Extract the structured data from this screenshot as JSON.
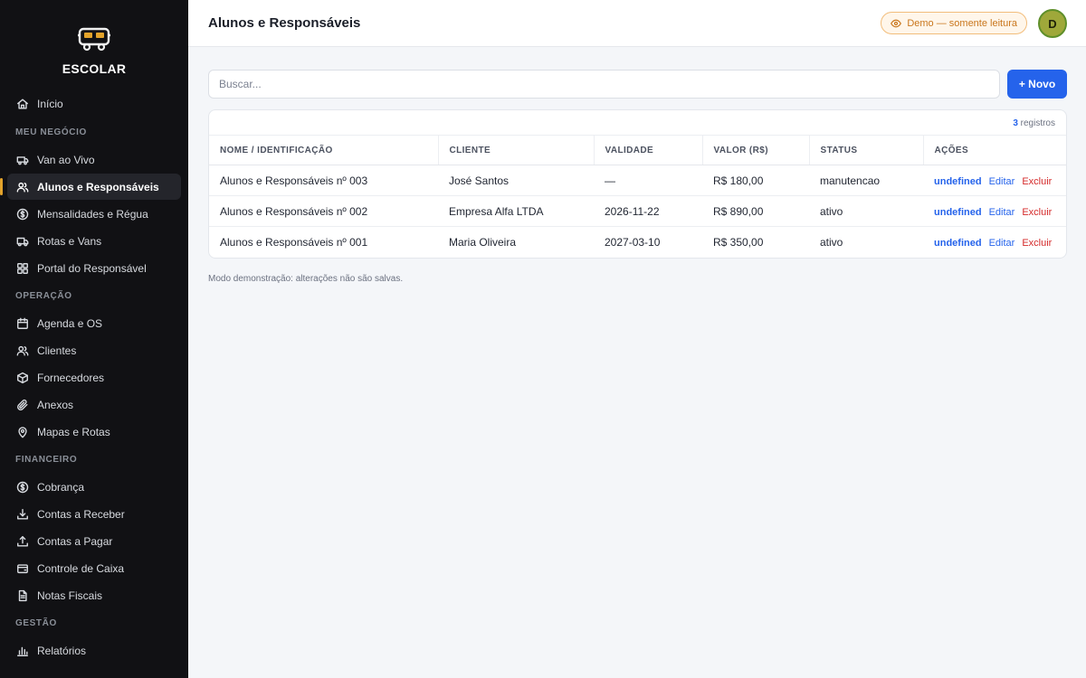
{
  "brand": {
    "name": "ESCOLAR",
    "logo_icon": "school-bus-icon"
  },
  "sidebar": {
    "top_items": [
      {
        "label": "Início",
        "icon": "home-icon"
      }
    ],
    "sections": [
      {
        "title": "MEU NEGÓCIO",
        "items": [
          {
            "label": "Van ao Vivo",
            "icon": "van-icon"
          },
          {
            "label": "Alunos e Responsáveis",
            "icon": "users-icon",
            "active": true
          },
          {
            "label": "Mensalidades e Régua",
            "icon": "dollar-circle-icon"
          },
          {
            "label": "Rotas e Vans",
            "icon": "truck-icon"
          },
          {
            "label": "Portal do Responsável",
            "icon": "grid-icon"
          }
        ]
      },
      {
        "title": "OPERAÇÃO",
        "items": [
          {
            "label": "Agenda e OS",
            "icon": "calendar-icon"
          },
          {
            "label": "Clientes",
            "icon": "users-icon"
          },
          {
            "label": "Fornecedores",
            "icon": "box-icon"
          },
          {
            "label": "Anexos",
            "icon": "paperclip-icon"
          },
          {
            "label": "Mapas e Rotas",
            "icon": "map-pin-icon"
          }
        ]
      },
      {
        "title": "FINANCEIRO",
        "items": [
          {
            "label": "Cobrança",
            "icon": "dollar-circle-icon"
          },
          {
            "label": "Contas a Receber",
            "icon": "download-icon"
          },
          {
            "label": "Contas a Pagar",
            "icon": "upload-icon"
          },
          {
            "label": "Controle de Caixa",
            "icon": "wallet-icon"
          },
          {
            "label": "Notas Fiscais",
            "icon": "file-text-icon"
          }
        ]
      },
      {
        "title": "GESTÃO",
        "items": [
          {
            "label": "Relatórios",
            "icon": "bar-chart-icon"
          }
        ]
      }
    ]
  },
  "header": {
    "title": "Alunos e Responsáveis",
    "demo_badge": "Demo — somente leitura",
    "avatar_initial": "D"
  },
  "toolbar": {
    "search_placeholder": "Buscar...",
    "new_label": "+ Novo"
  },
  "table": {
    "count": "3",
    "count_suffix": " registros",
    "columns": [
      "NOME / IDENTIFICAÇÃO",
      "CLIENTE",
      "VALIDADE",
      "VALOR (R$)",
      "STATUS",
      "AÇÕES"
    ],
    "rows": [
      {
        "name": "Alunos e Responsáveis nº 003",
        "client": "José Santos",
        "validity": "—",
        "value": "R$ 180,00",
        "status": "manutencao"
      },
      {
        "name": "Alunos e Responsáveis nº 002",
        "client": "Empresa Alfa LTDA",
        "validity": "2026-11-22",
        "value": "R$ 890,00",
        "status": "ativo"
      },
      {
        "name": "Alunos e Responsáveis nº 001",
        "client": "Maria Oliveira",
        "validity": "2027-03-10",
        "value": "R$ 350,00",
        "status": "ativo"
      }
    ],
    "actions": {
      "first": "undefined",
      "edit": "Editar",
      "delete": "Excluir"
    }
  },
  "footnote": "Modo demonstração: alterações não são salvas."
}
